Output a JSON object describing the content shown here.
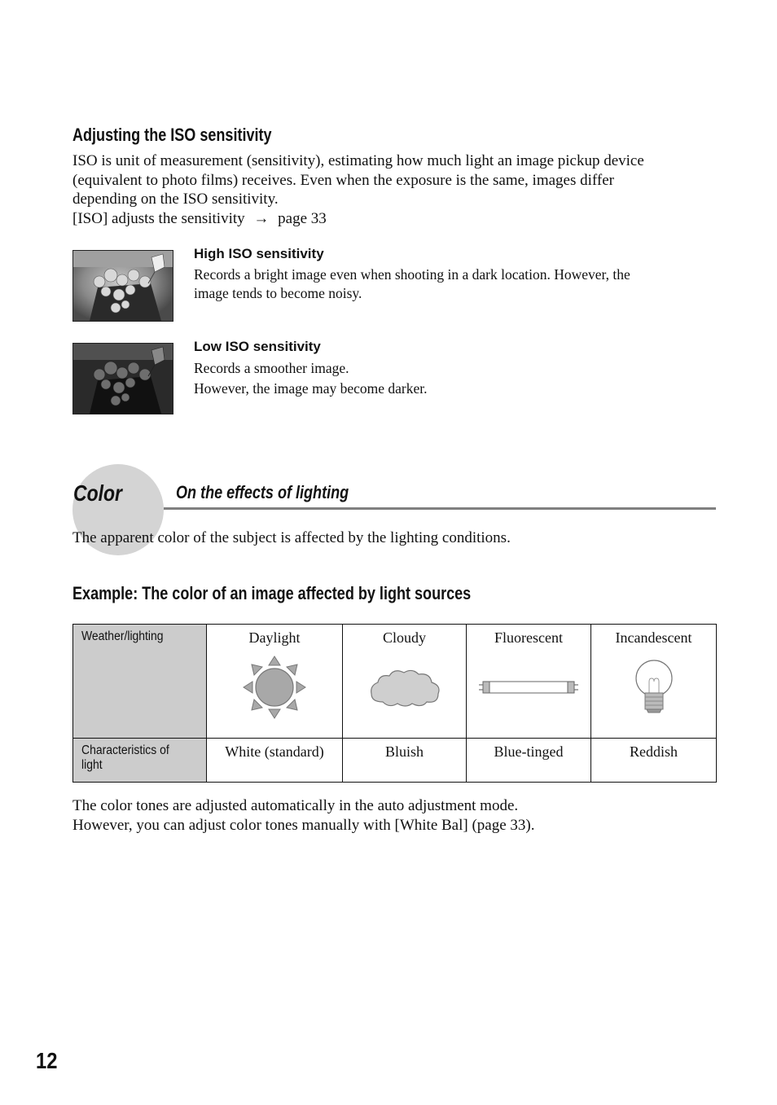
{
  "iso_section": {
    "heading": "Adjusting the ISO sensitivity",
    "paragraph_lines": [
      "ISO is unit of measurement (sensitivity), estimating how much light an image pickup device",
      "(equivalent to photo films) receives. Even when the exposure is the same, images differ",
      "depending on the ISO sensitivity."
    ],
    "reference": {
      "text": "[ISO] adjusts the sensitivity",
      "arrow_icon": "right-arrow-icon",
      "arrow": "→",
      "page": "page 33"
    },
    "examples": [
      {
        "title": "High ISO sensitivity",
        "image": "flowers-bright-photo",
        "lines": [
          "Records a bright image even when shooting in a dark location. However, the",
          "image tends to become noisy."
        ]
      },
      {
        "title": "Low ISO sensitivity",
        "image": "flowers-dark-photo",
        "lines": [
          "Records a smoother image.",
          "However, the image may become darker."
        ]
      }
    ]
  },
  "color_section": {
    "tab_label": "Color",
    "subtitle": "On the effects of lighting",
    "intro": "The apparent color of the subject is affected by the lighting conditions.",
    "example_heading": "Example: The color of an image affected by light sources",
    "table": {
      "row_headers": [
        "Weather/lighting",
        "Characteristics of light"
      ],
      "columns": [
        {
          "lighting": "Daylight",
          "icon": "sun-icon",
          "characteristic": "White (standard)"
        },
        {
          "lighting": "Cloudy",
          "icon": "cloud-icon",
          "characteristic": "Bluish"
        },
        {
          "lighting": "Fluorescent",
          "icon": "fluorescent-tube-icon",
          "characteristic": "Blue-tinged"
        },
        {
          "lighting": "Incandescent",
          "icon": "light-bulb-icon",
          "characteristic": "Reddish"
        }
      ]
    },
    "footer_lines": [
      "The color tones are adjusted automatically in the auto adjustment mode.",
      "However, you can adjust color tones manually with [White Bal] (page 33)."
    ]
  },
  "page_number": "12"
}
